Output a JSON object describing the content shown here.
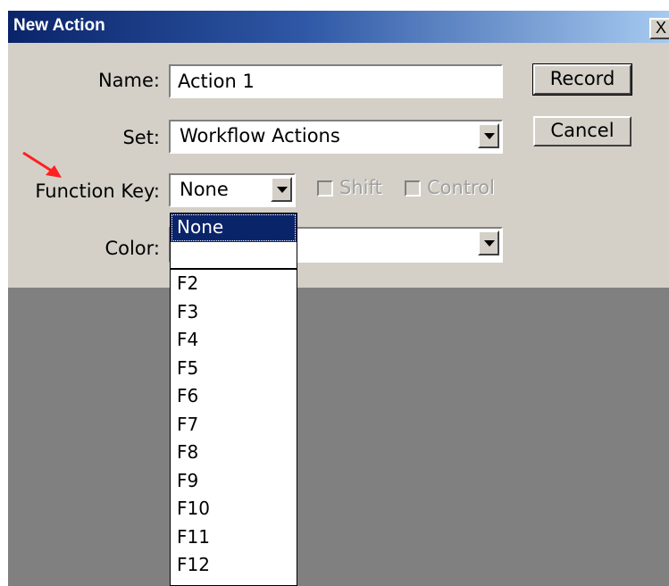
{
  "window": {
    "title": "New Action",
    "close_label": "X"
  },
  "form": {
    "name_label": "Name:",
    "name_value": "Action 1",
    "set_label": "Set:",
    "set_value": "Workflow Actions",
    "function_key_label": "Function Key:",
    "function_key_value": "None",
    "shift_label": "Shift",
    "control_label": "Control",
    "color_label": "Color:"
  },
  "buttons": {
    "record_label": "Record",
    "cancel_label": "Cancel"
  },
  "function_key_options": [
    "None",
    "",
    "F2",
    "F3",
    "F4",
    "F5",
    "F6",
    "F7",
    "F8",
    "F9",
    "F10",
    "F11",
    "F12"
  ],
  "colors": {
    "annotation_arrow": "#ff2020",
    "selection": "#0a246a"
  }
}
